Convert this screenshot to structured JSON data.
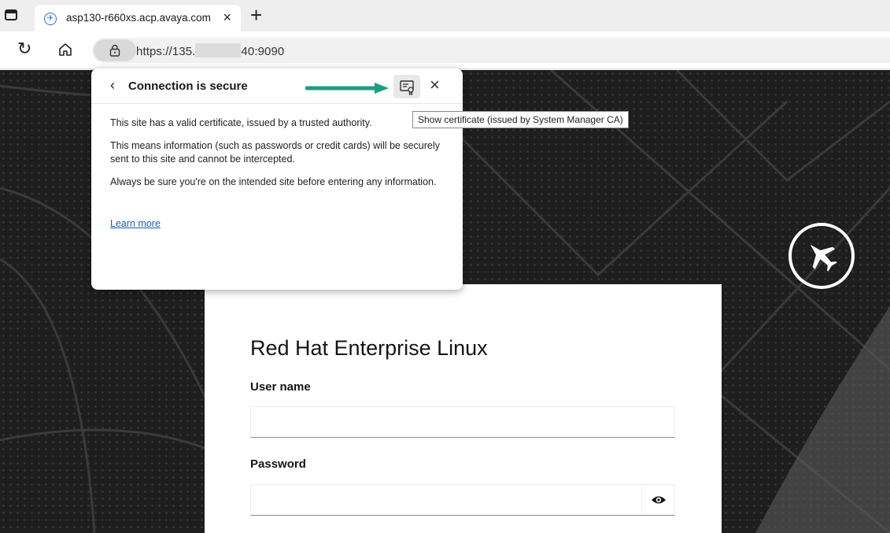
{
  "browser": {
    "tab": {
      "title": "asp130-r660xs.acp.avaya.com",
      "close": "×"
    },
    "new_tab": "+",
    "address": {
      "url_prefix": "https://135.",
      "url_suffix": "40:9090"
    }
  },
  "popup": {
    "title": "Connection is secure",
    "line1": "This site has a valid certificate, issued by a trusted authority.",
    "line2": "This means information (such as passwords or credit cards) will be securely sent to this site and cannot be intercepted.",
    "line3": "Always be sure you're on the intended site before entering any information.",
    "learn_more": "Learn more",
    "close": "×",
    "back": "‹"
  },
  "tooltip": "Show certificate (issued by System Manager CA)",
  "login": {
    "heading": "Red Hat Enterprise Linux",
    "username_label": "User name",
    "password_label": "Password",
    "username_value": "",
    "password_value": ""
  },
  "colors": {
    "arrow": "#1e9e7e",
    "link": "#1a5fb4"
  },
  "icons": [
    "tab-actions-icon",
    "favicon-plane-icon",
    "refresh-icon",
    "home-icon",
    "lock-icon",
    "certificate-icon",
    "close-icon",
    "eye-icon",
    "plane-icon"
  ]
}
